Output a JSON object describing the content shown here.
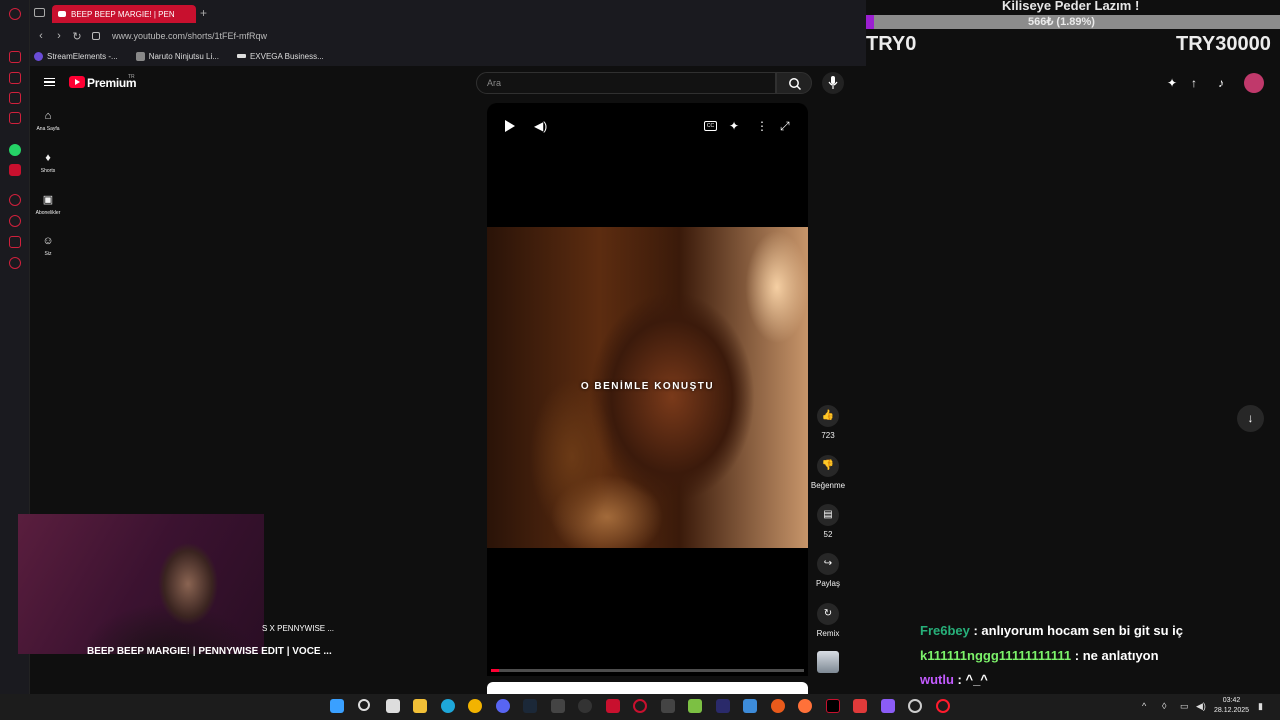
{
  "browser": {
    "tab_title": "BEEP BEEP MARGIE! | PEN",
    "new_tab": "+",
    "url": "www.youtube.com/shorts/1tFEf-mfRqw",
    "bookmarks": [
      "StreamElements -...",
      "Naruto Ninjutsu Li...",
      "EXVEGA Business..."
    ]
  },
  "youtube": {
    "logo_text": "Premium",
    "region": "TR",
    "search_placeholder": "Ara",
    "guide": [
      "Ana Sayfa",
      "Shorts",
      "Abonelikler",
      "Siz"
    ]
  },
  "short": {
    "caption": "O BENİMLE KONUŞTU",
    "progress": 0.025,
    "actions": {
      "likes": "723",
      "dislike_label": "Beğenme",
      "comments": "52",
      "share_label": "Paylaş",
      "remix_label": "Remix"
    }
  },
  "overlay": {
    "goal_title": "Kiliseye Peder Lazım !",
    "goal_progress_text": "566₺ (1.89%)",
    "goal_fraction": 0.0189,
    "left_amount": "TRY0",
    "right_amount": "TRY30000"
  },
  "webcam": {
    "line1": "S X PENNYWISE ...",
    "line2": "BEEP BEEP MARGIE! | PENNYWISE EDIT | VOCE ..."
  },
  "chat": [
    {
      "user": "Fre6bey",
      "message": " : anlıyorum hocam sen bi git su iç"
    },
    {
      "user": "k111111nggg11111111111",
      "message": " : ne anlatıyon"
    },
    {
      "user": "wutlu",
      "message": " : ^_^"
    }
  ],
  "system": {
    "time": "03:42",
    "date": "28.12.2025"
  },
  "colors": {
    "brand": "#ff0033",
    "browser_accent": "#c8102e",
    "goal_fill": "#9b1fd1"
  }
}
